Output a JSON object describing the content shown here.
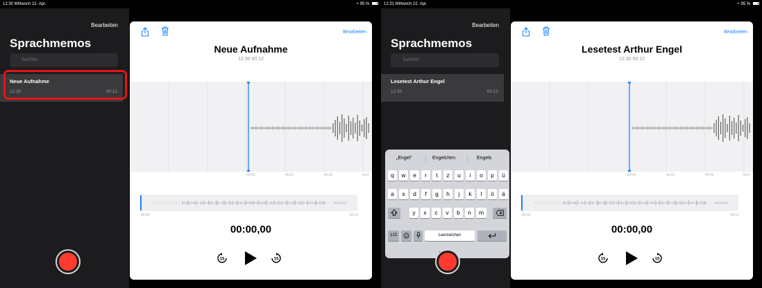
{
  "screens": [
    {
      "status": {
        "time": "12:30  Mittwoch 22. Apr.",
        "battery": "95 %"
      },
      "sidebar": {
        "edit_label": "Bearbeiten",
        "title": "Sprachmemos",
        "search_placeholder": "Suchen",
        "item": {
          "name": "Neue Aufnahme",
          "time": "12:30",
          "duration": "00:12"
        }
      },
      "detail": {
        "edit_label": "Bearbeiten",
        "title": "Neue Aufnahme",
        "meta": "12:30  00:12",
        "ticks": [
          "00:00",
          "00:01",
          "00:02",
          "00:0"
        ],
        "scrub_start": "00:00",
        "scrub_end": "00:12",
        "timer": "00:00,00"
      }
    },
    {
      "status": {
        "time": "12:31  Mittwoch 22. Apr.",
        "battery": "95 %"
      },
      "sidebar": {
        "edit_label": "Bearbeiten",
        "title": "Sprachmemos",
        "search_placeholder": "Suchen",
        "item": {
          "name": "Lesetest Arthur Engel",
          "time": "12:30",
          "duration": "00:12"
        }
      },
      "detail": {
        "edit_label": "Bearbeiten",
        "title": "Lesetest Arthur Engel",
        "meta": "12:30  00:12",
        "ticks": [
          "00:00",
          "00:01",
          "00:02",
          "00:0"
        ],
        "scrub_start": "00:00",
        "scrub_end": "00:12",
        "timer": "00:00,00"
      },
      "keyboard": {
        "suggestions": [
          "„Engel“",
          "Engelchen",
          "Engels"
        ],
        "row1": [
          "q",
          "w",
          "e",
          "r",
          "t",
          "z",
          "u",
          "i",
          "o",
          "p",
          "ü"
        ],
        "row2": [
          "a",
          "s",
          "d",
          "f",
          "g",
          "h",
          "j",
          "k",
          "l",
          "ö",
          "ä"
        ],
        "row3": [
          "y",
          "x",
          "c",
          "v",
          "b",
          "n",
          "m"
        ],
        "numbers_label": "123",
        "space_label": "Leerzeichen"
      }
    }
  ],
  "colors": {
    "accent": "#1a84ff",
    "record": "#ff3b30",
    "highlight": "#e8121a",
    "sidebar_bg": "#1c1c1e"
  },
  "icons": [
    "share-icon",
    "trash-icon",
    "rewind-15-icon",
    "play-icon",
    "forward-15-icon",
    "shift-icon",
    "delete-icon",
    "emoji-icon",
    "mic-icon",
    "return-icon"
  ]
}
